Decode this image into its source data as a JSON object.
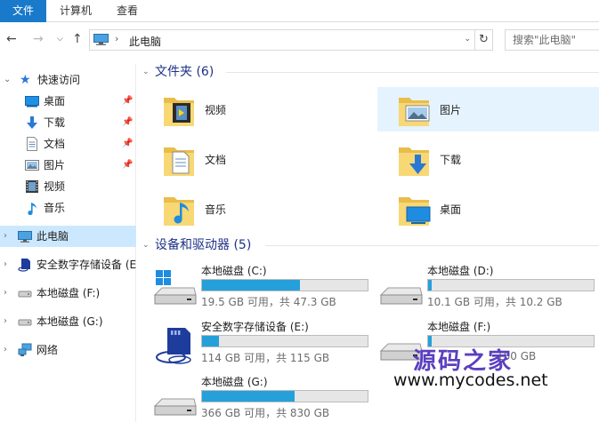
{
  "ribbon": {
    "tabs": [
      {
        "label": "文件",
        "active": true
      },
      {
        "label": "计算机",
        "active": false
      },
      {
        "label": "查看",
        "active": false
      }
    ],
    "accent": "#1979ca"
  },
  "address": {
    "path": "此电脑",
    "search_placeholder": "搜索\"此电脑\""
  },
  "sidebar": {
    "quick_access": "快速访问",
    "quick_items": [
      {
        "label": "桌面",
        "icon": "desktop-icon",
        "pinned": true
      },
      {
        "label": "下载",
        "icon": "download-icon",
        "pinned": true
      },
      {
        "label": "文档",
        "icon": "document-icon",
        "pinned": true
      },
      {
        "label": "图片",
        "icon": "pictures-icon",
        "pinned": true
      },
      {
        "label": "视频",
        "icon": "video-icon",
        "pinned": false
      },
      {
        "label": "音乐",
        "icon": "music-icon",
        "pinned": false
      }
    ],
    "this_pc": "此电脑",
    "sd_card": "安全数字存储设备 (E",
    "drive_f": "本地磁盘 (F:)",
    "drive_g": "本地磁盘 (G:)",
    "network": "网络",
    "selected_color": "#cce8ff"
  },
  "folders": {
    "header": "文件夹 (6)",
    "items": [
      {
        "label": "视频",
        "icon": "video-folder-icon"
      },
      {
        "label": "图片",
        "icon": "pictures-folder-icon"
      },
      {
        "label": "文档",
        "icon": "documents-folder-icon"
      },
      {
        "label": "下载",
        "icon": "downloads-folder-icon"
      },
      {
        "label": "音乐",
        "icon": "music-folder-icon"
      },
      {
        "label": "桌面",
        "icon": "desktop-folder-icon"
      }
    ]
  },
  "drives": {
    "header": "设备和驱动器 (5)",
    "items": [
      {
        "name": "本地磁盘 (C:)",
        "info": "19.5 GB 可用，共 47.3 GB",
        "used_fraction": 0.59,
        "icon": "windows-drive-icon"
      },
      {
        "name": "本地磁盘 (D:)",
        "info": "10.1 GB 可用，共 10.2 GB",
        "used_fraction": 0.02,
        "icon": "hard-drive-icon"
      },
      {
        "name": "安全数字存储设备 (E:)",
        "info": "114 GB 可用，共 115 GB",
        "used_fraction": 0.1,
        "icon": "sd-card-icon"
      },
      {
        "name": "本地磁盘 (F:)",
        "info": "100 GB",
        "used_fraction": 0.02,
        "icon": "hard-drive-icon"
      },
      {
        "name": "本地磁盘 (G:)",
        "info": "366 GB 可用，共 830 GB",
        "used_fraction": 0.56,
        "icon": "hard-drive-icon"
      }
    ],
    "bar_color": "#26a0da"
  },
  "watermark": {
    "cn": "源码之家",
    "en": "www.mycodes.net"
  }
}
